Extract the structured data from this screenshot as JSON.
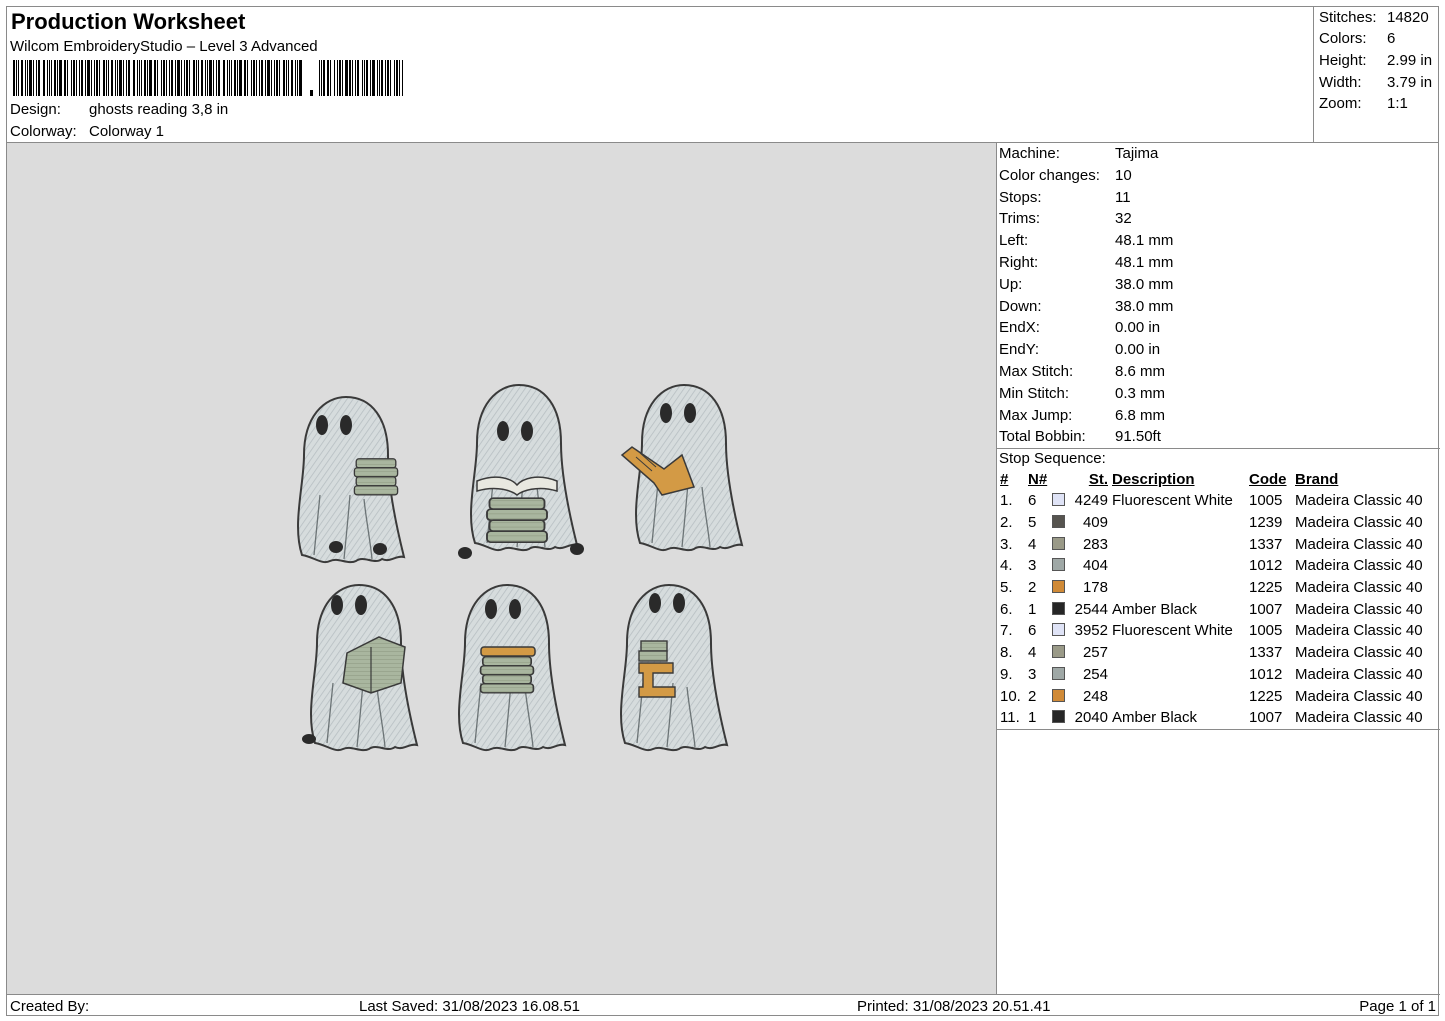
{
  "header": {
    "title": "Production Worksheet",
    "subtitle": "Wilcom EmbroideryStudio – Level 3 Advanced",
    "design_label": "Design:",
    "design_value": "ghosts reading 3,8 in",
    "colorway_label": "Colorway:",
    "colorway_value": "Colorway 1"
  },
  "stats": {
    "stitches_label": "Stitches:",
    "stitches": "14820",
    "colors_label": "Colors:",
    "colors": "6",
    "height_label": "Height:",
    "height": "2.99 in",
    "width_label": "Width:",
    "width": "3.79 in",
    "zoom_label": "Zoom:",
    "zoom": "1:1"
  },
  "machine_info": [
    {
      "label": "Machine:",
      "value": "Tajima"
    },
    {
      "label": "Color changes:",
      "value": "10"
    },
    {
      "label": "Stops:",
      "value": "11"
    },
    {
      "label": "Trims:",
      "value": "32"
    },
    {
      "label": "Left:",
      "value": "48.1 mm"
    },
    {
      "label": "Right:",
      "value": "48.1 mm"
    },
    {
      "label": "Up:",
      "value": "38.0 mm"
    },
    {
      "label": "Down:",
      "value": "38.0 mm"
    },
    {
      "label": "EndX:",
      "value": "0.00 in"
    },
    {
      "label": "EndY:",
      "value": "0.00 in"
    },
    {
      "label": "Max Stitch:",
      "value": "8.6 mm"
    },
    {
      "label": "Min Stitch:",
      "value": "0.3 mm"
    },
    {
      "label": "Max Jump:",
      "value": "6.8 mm"
    },
    {
      "label": "Total Bobbin:",
      "value": "91.50ft"
    }
  ],
  "stop_sequence": {
    "label": "Stop Sequence:",
    "headers": {
      "idx": "#",
      "n": "N#",
      "st": "St.",
      "desc": "Description",
      "code": "Code",
      "brand": "Brand"
    },
    "rows": [
      {
        "idx": "1.",
        "n": "6",
        "color": "#dfe3f6",
        "st": "4249",
        "desc": "Fluorescent White",
        "code": "1005",
        "brand": "Madeira Classic 40"
      },
      {
        "idx": "2.",
        "n": "5",
        "color": "#56544f",
        "st": "409",
        "desc": "",
        "code": "1239",
        "brand": "Madeira Classic 40"
      },
      {
        "idx": "3.",
        "n": "4",
        "color": "#9a9a88",
        "st": "283",
        "desc": "",
        "code": "1337",
        "brand": "Madeira Classic 40"
      },
      {
        "idx": "4.",
        "n": "3",
        "color": "#9fa8a6",
        "st": "404",
        "desc": "",
        "code": "1012",
        "brand": "Madeira Classic 40"
      },
      {
        "idx": "5.",
        "n": "2",
        "color": "#d08a37",
        "st": "178",
        "desc": "",
        "code": "1225",
        "brand": "Madeira Classic 40"
      },
      {
        "idx": "6.",
        "n": "1",
        "color": "#262626",
        "st": "2544",
        "desc": "Amber Black",
        "code": "1007",
        "brand": "Madeira Classic 40"
      },
      {
        "idx": "7.",
        "n": "6",
        "color": "#dfe3f6",
        "st": "3952",
        "desc": "Fluorescent White",
        "code": "1005",
        "brand": "Madeira Classic 40"
      },
      {
        "idx": "8.",
        "n": "4",
        "color": "#9a9a88",
        "st": "257",
        "desc": "",
        "code": "1337",
        "brand": "Madeira Classic 40"
      },
      {
        "idx": "9.",
        "n": "3",
        "color": "#9fa8a6",
        "st": "254",
        "desc": "",
        "code": "1012",
        "brand": "Madeira Classic 40"
      },
      {
        "idx": "10.",
        "n": "2",
        "color": "#d08a37",
        "st": "248",
        "desc": "",
        "code": "1225",
        "brand": "Madeira Classic 40"
      },
      {
        "idx": "11.",
        "n": "1",
        "color": "#262626",
        "st": "2040",
        "desc": "Amber Black",
        "code": "1007",
        "brand": "Madeira Classic 40"
      }
    ]
  },
  "footer": {
    "created_by": "Created By:",
    "last_saved": "Last Saved: 31/08/2023 16.08.51",
    "printed": "Printed: 31/08/2023 20.51.41",
    "page": "Page 1 of 1"
  },
  "colors": {
    "canvas_bg": "#dcdcdc",
    "ghost_fill": "#c9d0d2",
    "outline": "#3a3a3a",
    "book_green": "#a7b59e",
    "book_orange": "#d39a45"
  }
}
